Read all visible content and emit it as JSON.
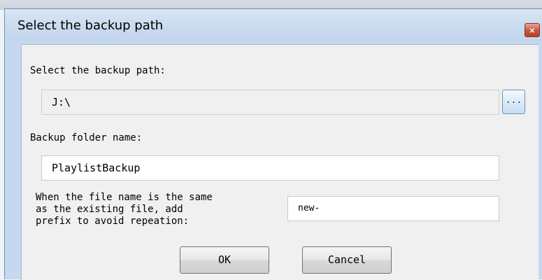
{
  "window": {
    "title": "Select the backup path",
    "close_glyph": "×"
  },
  "backup_path": {
    "label": "Select the backup path:",
    "value": "J:\\",
    "browse_label": "..."
  },
  "folder": {
    "label": "Backup folder name:",
    "value": "PlaylistBackup"
  },
  "prefix": {
    "label_lines": [
      "When the file name is the same",
      "as the existing file, add",
      "prefix to avoid repeation:"
    ],
    "value": "new-"
  },
  "buttons": {
    "ok": "OK",
    "cancel": "Cancel"
  },
  "colors": {
    "title_bar": "#c9dbef",
    "client_bg": "#f0f0f0",
    "close_button": "#c9533c"
  }
}
